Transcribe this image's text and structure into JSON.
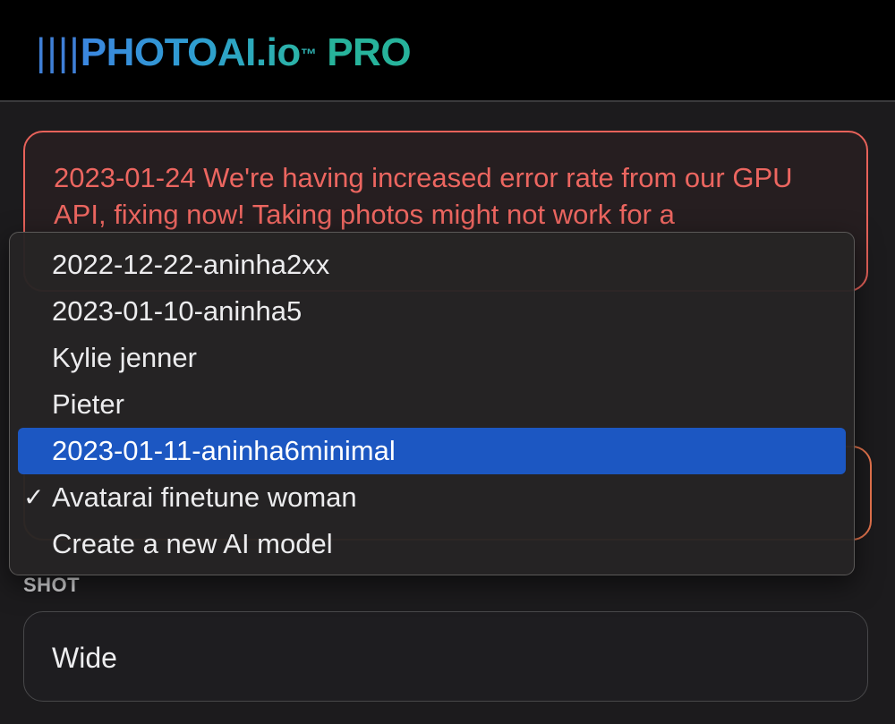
{
  "header": {
    "logo_bars": "||||",
    "logo_brand": "PHOTOAI.io",
    "logo_tm": "™",
    "logo_pro": "PRO"
  },
  "alert": {
    "text": "2023-01-24 We're having increased error rate from our GPU API, fixing now! Taking photos might not work for a"
  },
  "model_menu": {
    "items": [
      {
        "label": "2022-12-22-aninha2xx",
        "checked": false,
        "highlighted": false
      },
      {
        "label": "2023-01-10-aninha5",
        "checked": false,
        "highlighted": false
      },
      {
        "label": "Kylie jenner",
        "checked": false,
        "highlighted": false
      },
      {
        "label": "Pieter",
        "checked": false,
        "highlighted": false
      },
      {
        "label": "2023-01-11-aninha6minimal",
        "checked": false,
        "highlighted": true
      },
      {
        "label": "Avatarai finetune woman",
        "checked": true,
        "highlighted": false
      },
      {
        "label": "Create a new AI model",
        "checked": false,
        "highlighted": false
      }
    ],
    "check_glyph": "✓"
  },
  "shot": {
    "label": "SHOT",
    "value": "Wide"
  },
  "colors": {
    "alert": "#ec6660",
    "highlight": "#1c57c2",
    "brand_blue": "#3b86e0",
    "brand_teal": "#27b39b"
  },
  "icons": {
    "check": "checkmark-icon"
  }
}
